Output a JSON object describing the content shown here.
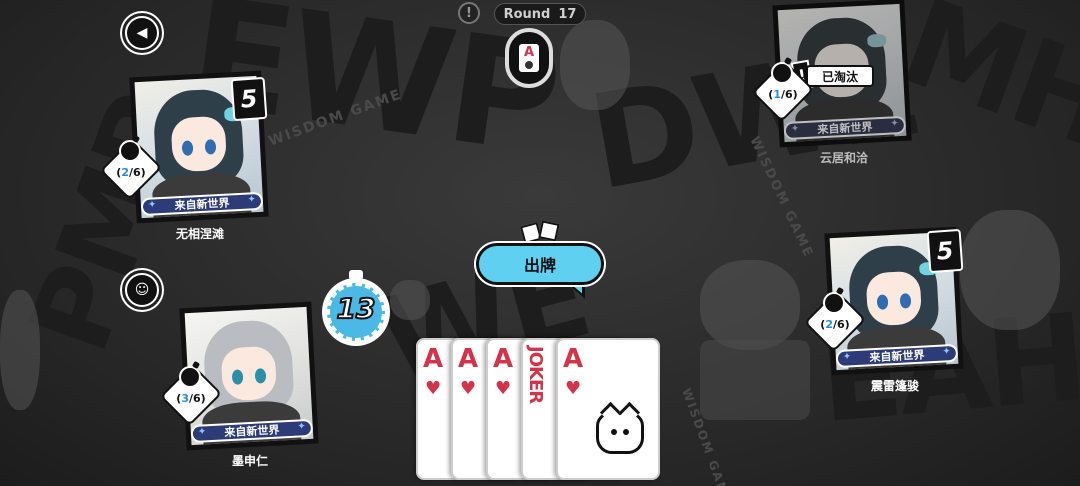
{
  "round": {
    "label": "Round",
    "number": "17"
  },
  "center": {
    "deck_rank": "A"
  },
  "play_button": {
    "label": "出牌"
  },
  "timer": {
    "seconds": "13"
  },
  "players": [
    {
      "name": "无相涅滩",
      "tag": "来自新世界",
      "bombs_current": "2",
      "bombs_total": "6",
      "level": "5"
    },
    {
      "name": "云居和洽",
      "tag": "来自新世界",
      "bombs_current": "1",
      "bombs_total": "6",
      "status": "已淘汰"
    },
    {
      "name": "墨申仁",
      "tag": "来自新世界",
      "bombs_current": "3",
      "bombs_total": "6"
    },
    {
      "name": "震雷篷骏",
      "tag": "来自新世界",
      "bombs_current": "2",
      "bombs_total": "6",
      "level": "5"
    }
  ],
  "hand": [
    {
      "rank": "A",
      "suit": "♥"
    },
    {
      "rank": "A",
      "suit": "♥"
    },
    {
      "rank": "A",
      "suit": "♥"
    },
    {
      "rank": "JOKER",
      "suit": ""
    },
    {
      "rank": "A",
      "suit": "♥"
    }
  ],
  "colors": {
    "accent": "#5fd0f0",
    "card_red": "#d3344a",
    "nameplate": "#2d3b78",
    "bomb_highlight": "#1f8fe3"
  },
  "icons": {
    "back": "back-arrow-icon",
    "emote": "emote-icon",
    "alert": "alert-icon"
  }
}
